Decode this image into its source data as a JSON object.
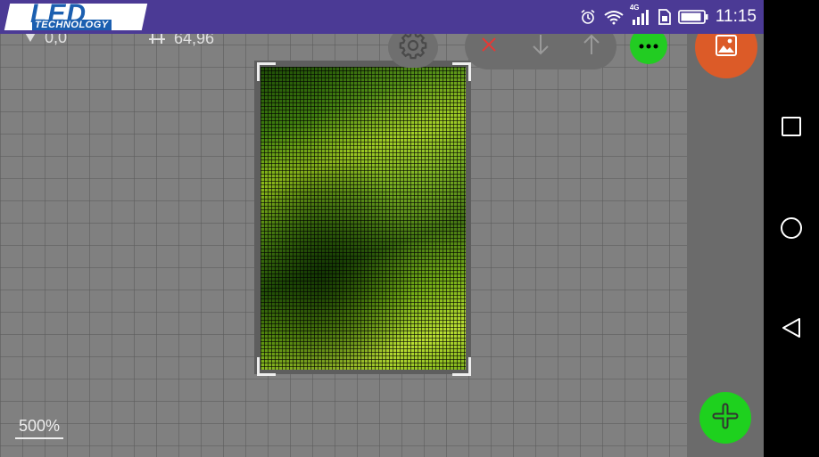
{
  "status_bar": {
    "logo_text": "LED",
    "logo_subtext": "TECHNOLOGY",
    "network_label": "4G",
    "time": "11:15"
  },
  "toolbar": {
    "origin_readout": "0,0",
    "size_readout": "64,96",
    "settings_icon": "gear-icon",
    "delete_icon": "close-icon",
    "move_down_icon": "arrow-down-icon",
    "move_up_icon": "arrow-up-icon",
    "more_icon": "more-dots-icon",
    "image_icon": "image-icon"
  },
  "canvas": {
    "zoom_label": "500%"
  },
  "fab": {
    "add_icon": "plus-icon"
  },
  "colors": {
    "status_bar": "#4b3a95",
    "delete_icon": "#e53935",
    "more_button": "#22cc22",
    "image_button": "#dc5b28",
    "add_button": "#1ed11e"
  },
  "nav": {
    "recents_icon": "square-icon",
    "home_icon": "circle-icon",
    "back_icon": "triangle-back-icon"
  }
}
